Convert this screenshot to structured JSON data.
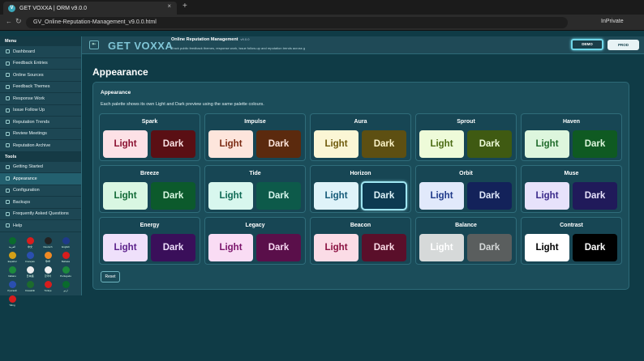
{
  "browser": {
    "tab_title": "GET VOXXA | ORM v9.0.0",
    "favicon_letter": "V",
    "close_glyph": "×",
    "new_tab_glyph": "+",
    "back_glyph": "←",
    "reload_glyph": "↻",
    "url": "GV_Online-Reputation-Management_v9.0.0.html",
    "mode": "InPrivate"
  },
  "header": {
    "menu_glyph": "⇤",
    "logo": "GET VOXXA",
    "app_title": "Online Reputation Management",
    "app_version": "v9.0.0",
    "app_desc": "Track public feedback themes, response work, issue follow-up and reputation trends across g",
    "demo_label": "DEMO",
    "prod_label": "PROD"
  },
  "sidebar": {
    "menu_title": "Menu",
    "menu_items": [
      {
        "label": "Dashboard"
      },
      {
        "label": "Feedback Entries"
      },
      {
        "label": "Online Sources"
      },
      {
        "label": "Feedback Themes"
      },
      {
        "label": "Response Work"
      },
      {
        "label": "Issue Follow Up"
      },
      {
        "label": "Reputation Trends"
      },
      {
        "label": "Review Meetings"
      },
      {
        "label": "Reputation Archive"
      }
    ],
    "tools_title": "Tools",
    "tools_items": [
      {
        "label": "Getting Started"
      },
      {
        "label": "Appearance"
      },
      {
        "label": "Configuration"
      },
      {
        "label": "Backups"
      },
      {
        "label": "Frequently Asked Questions"
      },
      {
        "label": "Help"
      }
    ],
    "flags": [
      {
        "label": "العربية",
        "color": "#0a6b2d"
      },
      {
        "label": "中文",
        "color": "#d71d1d"
      },
      {
        "label": "Deutsch",
        "color": "#222222"
      },
      {
        "label": "English",
        "color": "#1e3a8a"
      },
      {
        "label": "Español",
        "color": "#d4a017"
      },
      {
        "label": "Français",
        "color": "#2a4fb0"
      },
      {
        "label": "हिन्दी",
        "color": "#f08a24"
      },
      {
        "label": "Bahasa",
        "color": "#d71d1d"
      },
      {
        "label": "Italiano",
        "color": "#1c8a3c"
      },
      {
        "label": "日本語",
        "color": "#eeeeee"
      },
      {
        "label": "한국어",
        "color": "#f2f2f2"
      },
      {
        "label": "Português",
        "color": "#1c8a3c"
      },
      {
        "label": "Русский",
        "color": "#2a4fb0"
      },
      {
        "label": "Kiswahili",
        "color": "#1c6b2d"
      },
      {
        "label": "Türkçe",
        "color": "#d71d1d"
      },
      {
        "label": "اردو",
        "color": "#0a6b2d"
      },
      {
        "label": "Tiếng",
        "color": "#d71d1d"
      }
    ]
  },
  "main": {
    "page_title": "Appearance",
    "panel_title": "Appearance",
    "panel_desc": "Each palette shows its own Light and Dark preview using the same palette colours.",
    "light_label": "Light",
    "dark_label": "Dark",
    "reset_label": "Reset",
    "palettes": [
      {
        "name": "Spark",
        "light_bg": "#fde1e6",
        "light_fg": "#8a1030",
        "dark_bg": "#5a0f14",
        "dark_fg": "#fbe2e4"
      },
      {
        "name": "Impulse",
        "light_bg": "#fde5dc",
        "light_fg": "#7a2a12",
        "dark_bg": "#5b2a0e",
        "dark_fg": "#fde5dc"
      },
      {
        "name": "Aura",
        "light_bg": "#fbf6d5",
        "light_fg": "#6e5a0a",
        "dark_bg": "#5d4f12",
        "dark_fg": "#fbf3c8"
      },
      {
        "name": "Sprout",
        "light_bg": "#eefbd9",
        "light_fg": "#4b6b13",
        "dark_bg": "#3f5a12",
        "dark_fg": "#eefbd9"
      },
      {
        "name": "Haven",
        "light_bg": "#ddf6dd",
        "light_fg": "#1f6b2a",
        "dark_bg": "#0f5a22",
        "dark_fg": "#ddf6dd"
      },
      {
        "name": "Breeze",
        "light_bg": "#d9f7e2",
        "light_fg": "#126a36",
        "dark_bg": "#0c5a2c",
        "dark_fg": "#d9f7e2"
      },
      {
        "name": "Tide",
        "light_bg": "#d8f7ee",
        "light_fg": "#0f6a55",
        "dark_bg": "#0d5a4a",
        "dark_fg": "#d8f7ee"
      },
      {
        "name": "Horizon",
        "light_bg": "#dff3f9",
        "light_fg": "#155a78",
        "dark_bg": "#0d3a52",
        "dark_fg": "#dff3f9",
        "selected": "dark"
      },
      {
        "name": "Orbit",
        "light_bg": "#e1e9fb",
        "light_fg": "#1f3a8a",
        "dark_bg": "#13225a",
        "dark_fg": "#e1e9fb"
      },
      {
        "name": "Muse",
        "light_bg": "#e7e2fb",
        "light_fg": "#3a2a8a",
        "dark_bg": "#201a5a",
        "dark_fg": "#e7e2fb"
      },
      {
        "name": "Energy",
        "light_bg": "#efe0fb",
        "light_fg": "#5a1f8a",
        "dark_bg": "#3a0f5a",
        "dark_fg": "#efe0fb"
      },
      {
        "name": "Legacy",
        "light_bg": "#f9dcf4",
        "light_fg": "#7a126a",
        "dark_bg": "#5a0f4a",
        "dark_fg": "#f9dcf4"
      },
      {
        "name": "Beacon",
        "light_bg": "#fbdce6",
        "light_fg": "#8a1040",
        "dark_bg": "#5a0f2a",
        "dark_fg": "#fbdce6"
      },
      {
        "name": "Balance",
        "light_bg": "#d6d9d9",
        "light_fg": "#ffffff",
        "dark_bg": "#5a5e5e",
        "dark_fg": "#d6d9d9"
      },
      {
        "name": "Contrast",
        "light_bg": "#ffffff",
        "light_fg": "#000000",
        "dark_bg": "#000000",
        "dark_fg": "#ffffff"
      }
    ]
  }
}
